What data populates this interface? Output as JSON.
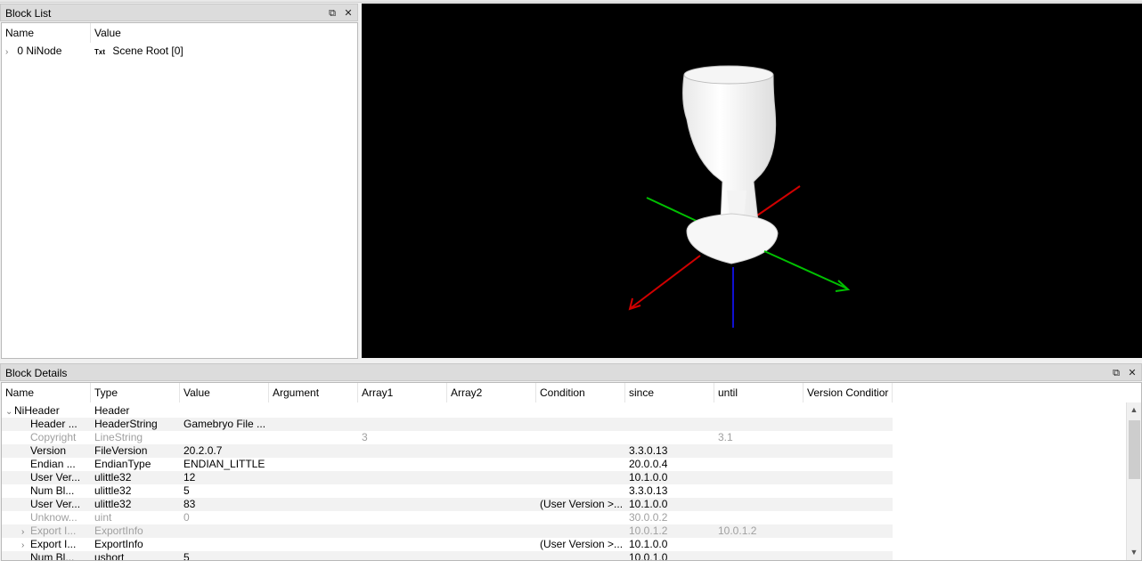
{
  "block_list": {
    "title": "Block List",
    "restore_icon": "⧉",
    "close_icon": "✕",
    "columns": [
      "Name",
      "Value"
    ],
    "rows": [
      {
        "expander": "›",
        "name": "0 NiNode",
        "icon": "Txt",
        "value": "Scene Root [0]"
      }
    ]
  },
  "viewport": {
    "description_icon": "3d-goblet-model"
  },
  "block_details": {
    "title": "Block Details",
    "restore_icon": "⧉",
    "close_icon": "✕",
    "columns": [
      "Name",
      "Type",
      "Value",
      "Argument",
      "Array1",
      "Array2",
      "Condition",
      "since",
      "until",
      "Version Conditior"
    ],
    "rows": [
      {
        "expander": "⌄",
        "name": "NiHeader",
        "type": "Header",
        "value": "",
        "argument": "",
        "array1": "",
        "array2": "",
        "condition": "",
        "since": "",
        "until": "",
        "grey": false,
        "indent": 0
      },
      {
        "expander": "",
        "name": "Header ...",
        "type": "HeaderString",
        "value": "Gamebryo File ...",
        "argument": "",
        "array1": "",
        "array2": "",
        "condition": "",
        "since": "",
        "until": "",
        "grey": false,
        "indent": 1
      },
      {
        "expander": "",
        "name": "Copyright",
        "type": "LineString",
        "value": "",
        "argument": "",
        "array1": "3",
        "array2": "",
        "condition": "",
        "since": "",
        "until": "3.1",
        "grey": true,
        "indent": 1
      },
      {
        "expander": "",
        "name": "Version",
        "type": "FileVersion",
        "value": "20.2.0.7",
        "argument": "",
        "array1": "",
        "array2": "",
        "condition": "",
        "since": "3.3.0.13",
        "until": "",
        "grey": false,
        "indent": 1
      },
      {
        "expander": "",
        "name": "Endian ...",
        "type": "EndianType",
        "value": "ENDIAN_LITTLE",
        "argument": "",
        "array1": "",
        "array2": "",
        "condition": "",
        "since": "20.0.0.4",
        "until": "",
        "grey": false,
        "indent": 1
      },
      {
        "expander": "",
        "name": "User Ver...",
        "type": "ulittle32",
        "value": "12",
        "argument": "",
        "array1": "",
        "array2": "",
        "condition": "",
        "since": "10.1.0.0",
        "until": "",
        "grey": false,
        "indent": 1
      },
      {
        "expander": "",
        "name": "Num Bl...",
        "type": "ulittle32",
        "value": "5",
        "argument": "",
        "array1": "",
        "array2": "",
        "condition": "",
        "since": "3.3.0.13",
        "until": "",
        "grey": false,
        "indent": 1
      },
      {
        "expander": "",
        "name": "User Ver...",
        "type": "ulittle32",
        "value": "83",
        "argument": "",
        "array1": "",
        "array2": "",
        "condition": "(User Version >...",
        "since": "10.1.0.0",
        "until": "",
        "grey": false,
        "indent": 1
      },
      {
        "expander": "",
        "name": "Unknow...",
        "type": "uint",
        "value": "0",
        "argument": "",
        "array1": "",
        "array2": "",
        "condition": "",
        "since": "30.0.0.2",
        "until": "",
        "grey": true,
        "indent": 1
      },
      {
        "expander": "›",
        "name": "Export I...",
        "type": "ExportInfo",
        "value": "",
        "argument": "",
        "array1": "",
        "array2": "",
        "condition": "",
        "since": "10.0.1.2",
        "until": "10.0.1.2",
        "grey": true,
        "indent": 1
      },
      {
        "expander": "›",
        "name": "Export I...",
        "type": "ExportInfo",
        "value": "",
        "argument": "",
        "array1": "",
        "array2": "",
        "condition": "(User Version >...",
        "since": "10.1.0.0",
        "until": "",
        "grey": false,
        "indent": 1
      },
      {
        "expander": "",
        "name": "Num Bl...",
        "type": "ushort",
        "value": "5",
        "argument": "",
        "array1": "",
        "array2": "",
        "condition": "",
        "since": "10.0.1.0",
        "until": "",
        "grey": false,
        "indent": 1
      }
    ]
  }
}
